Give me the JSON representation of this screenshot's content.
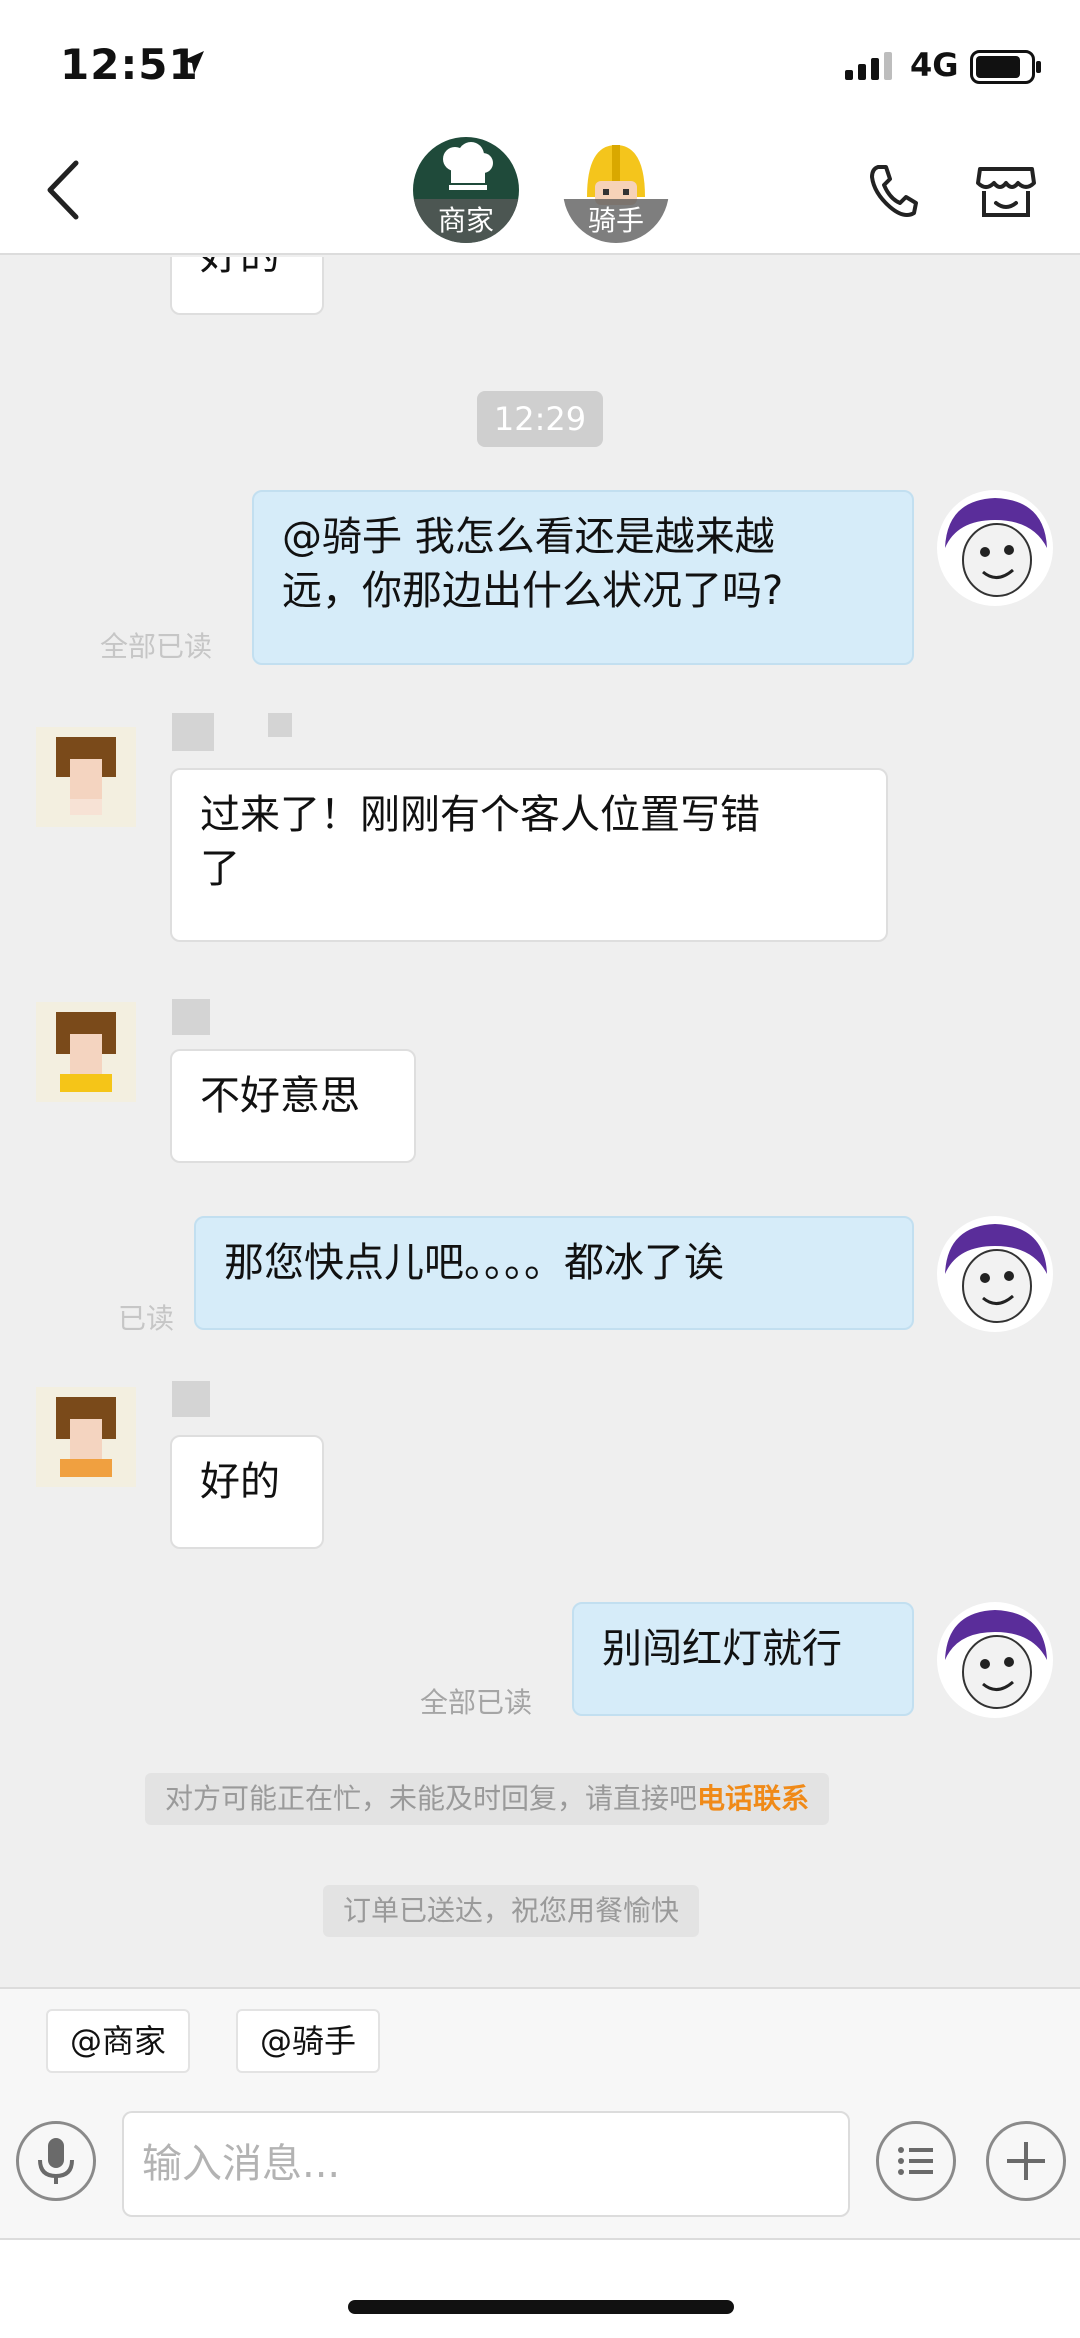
{
  "status_bar": {
    "time": "12:51",
    "network": "4G"
  },
  "header": {
    "merchant_tag": "商家",
    "rider_tag": "骑手",
    "icons": [
      "back-chevron-icon",
      "phone-icon",
      "shop-icon"
    ]
  },
  "chat": {
    "partial_top_text": "好的",
    "time_divider": "12:29",
    "messages": [
      {
        "side": "out",
        "text": "@骑手 我怎么看还是越来越远，你那边出什么状况了吗?",
        "line1": "@骑手 我怎么看还是越来越",
        "line2": "远，你那边出什么状况了吗?"
      },
      {
        "side": "in",
        "text": "过来了！刚刚有个客人位置写错了",
        "line1": "过来了！刚刚有个客人位置写错",
        "line2": "了"
      },
      {
        "side": "in",
        "text": "不好意思"
      },
      {
        "side": "out",
        "text": "那您快点儿吧。。。。都冰了诶"
      },
      {
        "side": "in",
        "text": "好的"
      },
      {
        "side": "out",
        "text": "别闯红灯就行",
        "status": "全部已读"
      }
    ],
    "read_label_1": "全部已读",
    "read_label_2": "已读",
    "system_notice_1": "对方可能正在忙，未能及时回复，请直接吧",
    "system_notice_1_link": "电话联系",
    "system_notice_2": "订单已送达，祝您用餐愉快"
  },
  "quick_replies": [
    "@商家",
    "@骑手"
  ],
  "input": {
    "placeholder": "输入消息..."
  },
  "colors": {
    "outgoing_bubble": "#d6ecf9",
    "incoming_bubble": "#ffffff",
    "link_orange": "#f08a18",
    "background": "#efefef"
  }
}
